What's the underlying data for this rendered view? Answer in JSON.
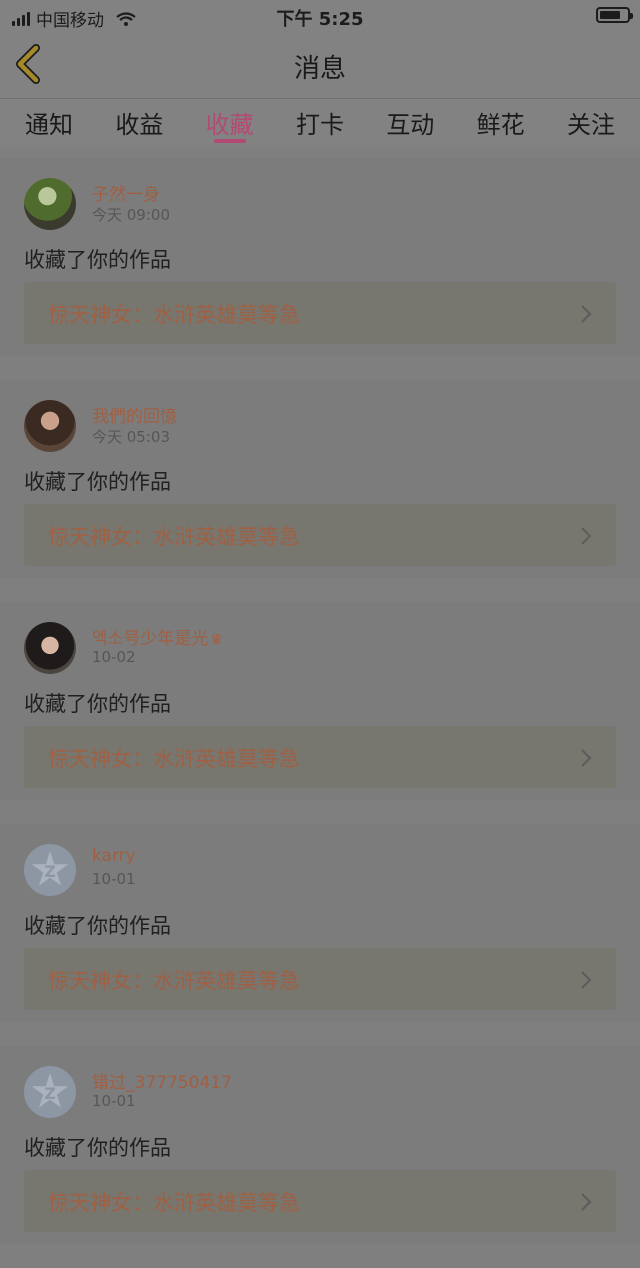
{
  "status_bar": {
    "carrier": "中国移动",
    "time": "下午 5:25"
  },
  "header": {
    "title": "消息"
  },
  "tabs": [
    {
      "label": "通知"
    },
    {
      "label": "收益"
    },
    {
      "label": "收藏",
      "active": true
    },
    {
      "label": "打卡"
    },
    {
      "label": "互动"
    },
    {
      "label": "鲜花"
    },
    {
      "label": "关注"
    }
  ],
  "messages": [
    {
      "user": "子然一身",
      "time": "今天 09:00",
      "action": "收藏了你的作品",
      "work_title": "惊天神女：水浒英雄莫等急",
      "avatar": "photo"
    },
    {
      "user": "我們的回憶",
      "time": "今天 05:03",
      "action": "收藏了你的作品",
      "work_title": "惊天神女：水浒英雄莫等急",
      "avatar": "photo"
    },
    {
      "user": "엑소号少年是光",
      "badge": "crown-icon",
      "time": "10-02",
      "action": "收藏了你的作品",
      "work_title": "惊天神女：水浒英雄莫等急",
      "avatar": "photo"
    },
    {
      "user": "karry",
      "time": "10-01",
      "action": "收藏了你的作品",
      "work_title": "惊天神女：水浒英雄莫等急",
      "avatar": "default-star-avatar"
    },
    {
      "user": "错过_377750417",
      "time": "10-01",
      "action": "收藏了你的作品",
      "work_title": "惊天神女：水浒英雄莫等急",
      "avatar": "default-star-avatar"
    }
  ],
  "colors": {
    "accent": "#b24a73",
    "username": "#a05f42",
    "overlay_background": "#7f7f7f"
  }
}
